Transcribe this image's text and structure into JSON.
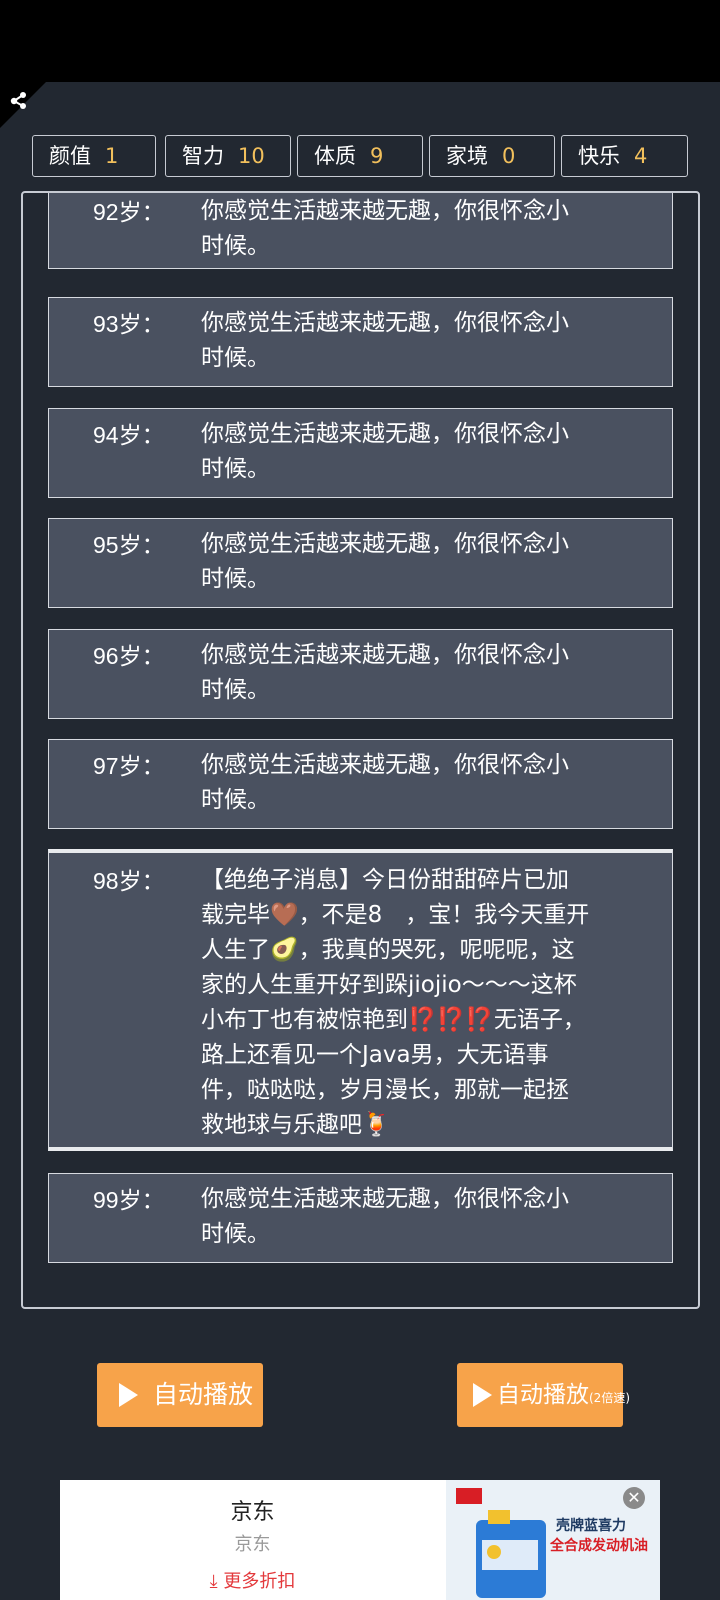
{
  "stats": [
    {
      "label": "颜值",
      "value": "1"
    },
    {
      "label": "智力",
      "value": "10"
    },
    {
      "label": "体质",
      "value": "9"
    },
    {
      "label": "家境",
      "value": "0"
    },
    {
      "label": "快乐",
      "value": "4"
    }
  ],
  "log": [
    {
      "age": "92岁：",
      "lines": [
        "你感觉生活越来越无趣，你很怀念小",
        "时候。"
      ]
    },
    {
      "age": "93岁：",
      "lines": [
        "你感觉生活越来越无趣，你很怀念小",
        "时候。"
      ]
    },
    {
      "age": "94岁：",
      "lines": [
        "你感觉生活越来越无趣，你很怀念小",
        "时候。"
      ]
    },
    {
      "age": "95岁：",
      "lines": [
        "你感觉生活越来越无趣，你很怀念小",
        "时候。"
      ]
    },
    {
      "age": "96岁：",
      "lines": [
        "你感觉生活越来越无趣，你很怀念小",
        "时候。"
      ]
    },
    {
      "age": "97岁：",
      "lines": [
        "你感觉生活越来越无趣，你很怀念小",
        "时候。"
      ]
    },
    {
      "age": "98岁：",
      "lines": [
        "【绝绝子消息】今日份甜甜碎片已加",
        "载完毕🤎，不是8　，宝！我今天重开",
        "人生了🥑，我真的哭死，呢呢呢，这",
        "家的人生重开好到跺jiojio～～～这杯",
        "小布丁也有被惊艳到⁉️⁉️⁉️无语子，",
        "路上还看见一个Java男，大无语事",
        "件，哒哒哒，岁月漫长，那就一起拯",
        "救地球与乐趣吧🍹"
      ]
    },
    {
      "age": "99岁：",
      "lines": [
        "你感觉生活越来越无趣，你很怀念小",
        "时候。"
      ]
    }
  ],
  "buttons": {
    "auto_play": "自动播放",
    "auto_play_fast": "自动播放",
    "auto_play_fast_sub": "(2倍速)"
  },
  "ad": {
    "title": "京东",
    "subtitle": "京东",
    "more": "更多折扣",
    "headline1": "壳牌蓝喜力",
    "headline2": "全合成发动机油",
    "close_icon": "close-icon"
  },
  "colors": {
    "accent": "#f7a34a",
    "stat_value": "#f2c05c",
    "card": "#4a5160",
    "background": "#222831"
  }
}
